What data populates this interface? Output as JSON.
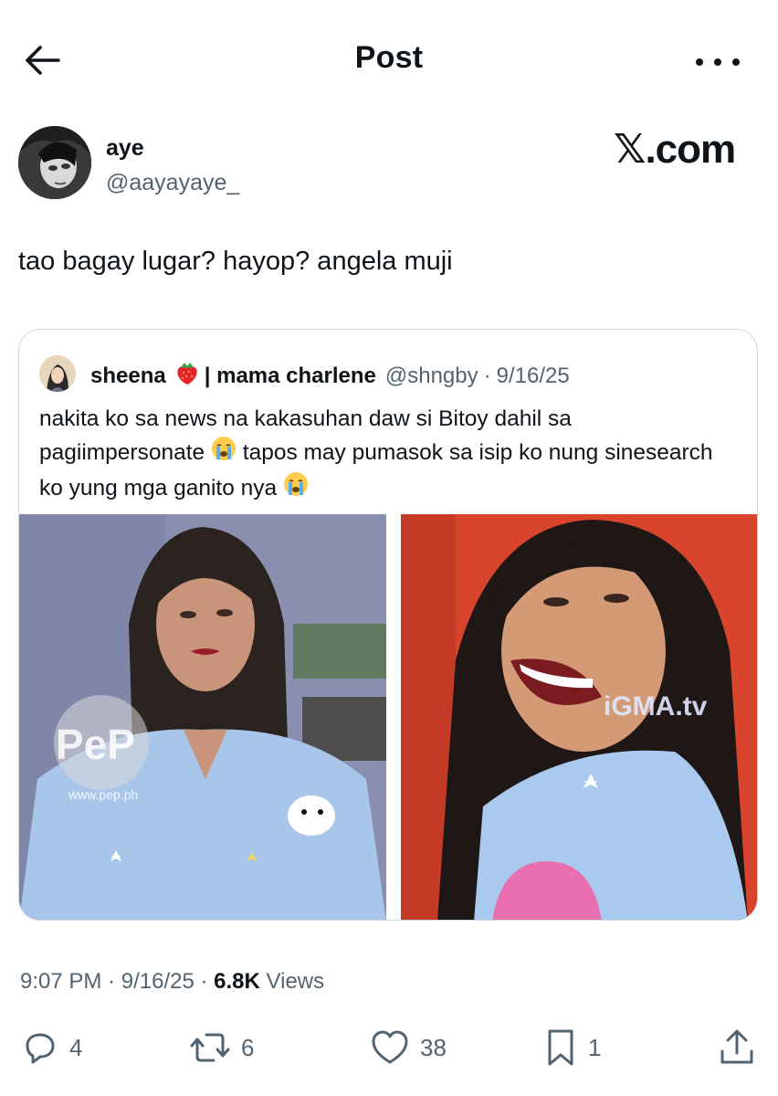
{
  "header": {
    "title": "Post",
    "back_icon": "arrow-left-icon",
    "more_icon": "more-horizontal-icon"
  },
  "author": {
    "name": "aye",
    "handle": "@aayayaye_",
    "watermark": "𝕏.com"
  },
  "post": {
    "text": "tao bagay lugar? hayop? angela muji"
  },
  "quote": {
    "name": "sheena",
    "name_suffix": "| mama charlene",
    "handle": "@shngby",
    "date": "9/16/25",
    "text_part1": "nakita ko sa news na kakasuhan daw si Bitoy dahil sa pagiimpersonate",
    "text_part2": "tapos may pumasok sa isip ko nung sinesearch ko yung mga ganito nya",
    "image_left_watermark": "PeP",
    "image_left_url": "www.pep.ph",
    "image_right_watermark": "iGMA.tv"
  },
  "meta": {
    "time": "9:07 PM",
    "date": "9/16/25",
    "views_count": "6.8K",
    "views_label": "Views"
  },
  "actions": {
    "replies": "4",
    "reposts": "6",
    "likes": "38",
    "bookmarks": "1"
  },
  "colors": {
    "text": "#0f1419",
    "secondary": "#536471",
    "border": "#cfd9de"
  }
}
